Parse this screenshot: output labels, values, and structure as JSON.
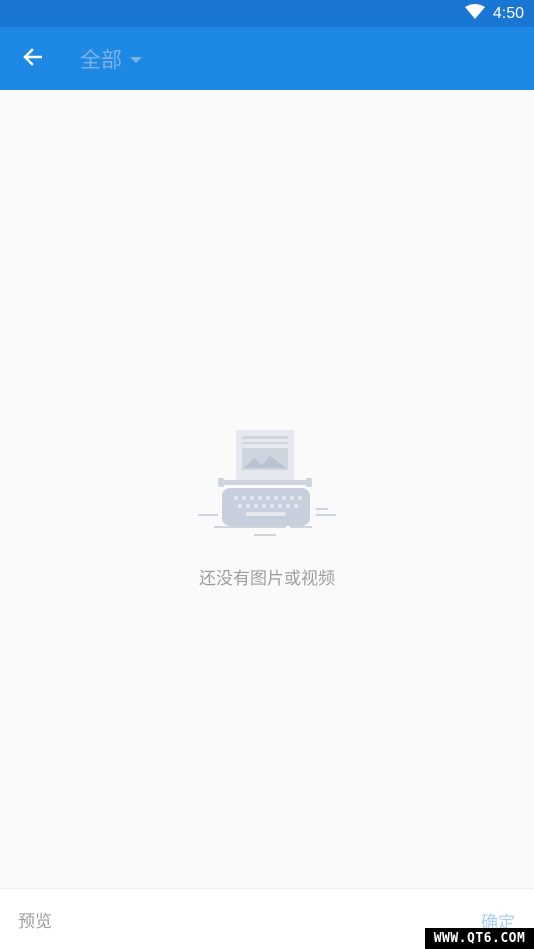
{
  "status_bar": {
    "time": "4:50",
    "icons": [
      "wifi-icon"
    ]
  },
  "app_bar": {
    "back_icon": "arrow-back-icon",
    "album_title": "全部",
    "dropdown_icon": "caret-down-icon"
  },
  "empty_state": {
    "illustration": "typewriter-illustration",
    "message": "还没有图片或视频"
  },
  "bottom_bar": {
    "preview_label": "预览",
    "confirm_label": "确定"
  },
  "watermark": {
    "text": "WWW.QT6.COM"
  },
  "colors": {
    "status_bar": "#1976d2",
    "app_bar": "#1e88e5",
    "background": "#fafafa",
    "confirm_disabled": "#a9cef3"
  }
}
